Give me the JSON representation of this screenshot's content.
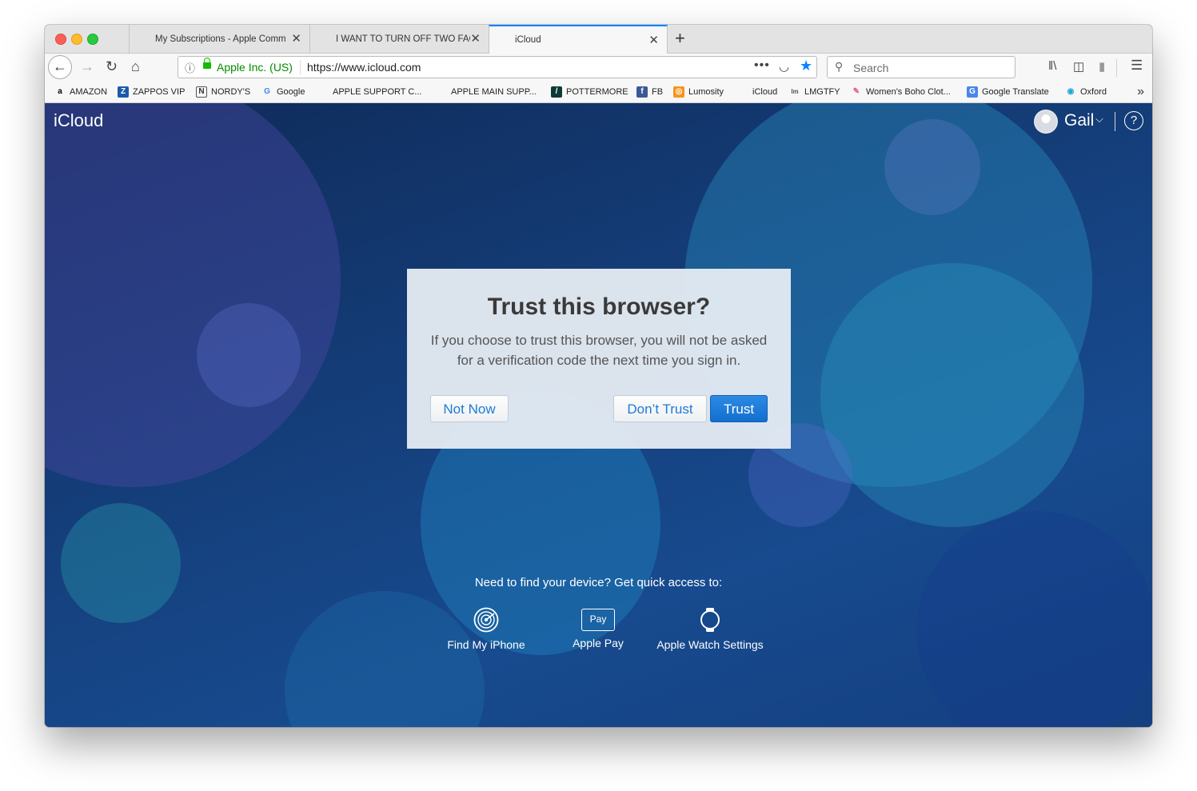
{
  "browser": {
    "tabs": [
      {
        "title": "My Subscriptions - Apple Comm",
        "icon": "apple-icon",
        "active": false
      },
      {
        "title": "I WANT TO TURN OFF TWO FAC",
        "icon": "apple-icon",
        "active": false
      },
      {
        "title": "iCloud",
        "icon": "apple-icon",
        "active": true
      }
    ],
    "url": {
      "organization": "Apple Inc. (US)",
      "address": "https://www.icloud.com"
    },
    "search": {
      "placeholder": "Search"
    },
    "bookmarks": [
      {
        "label": "AMAZON",
        "icon": "amazon-icon"
      },
      {
        "label": "ZAPPOS VIP",
        "icon": "zappos-icon"
      },
      {
        "label": "NORDY'S",
        "icon": "nordstrom-icon"
      },
      {
        "label": "Google",
        "icon": "google-icon"
      },
      {
        "label": "APPLE SUPPORT C...",
        "icon": "apple-icon"
      },
      {
        "label": "APPLE MAIN SUPP...",
        "icon": "apple-icon"
      },
      {
        "label": "POTTERMORE",
        "icon": "pottermore-icon"
      },
      {
        "label": "FB",
        "icon": "facebook-icon"
      },
      {
        "label": "Lumosity",
        "icon": "lumosity-icon"
      },
      {
        "label": "iCloud",
        "icon": "apple-icon"
      },
      {
        "label": "LMGTFY",
        "icon": "lmgtfy-icon"
      },
      {
        "label": "Women's Boho Clot...",
        "icon": "boho-icon"
      },
      {
        "label": "Google Translate",
        "icon": "google-translate-icon"
      },
      {
        "label": "Oxford",
        "icon": "oxford-icon"
      }
    ],
    "accent": "#0a84ff"
  },
  "icloud": {
    "brand": "iCloud",
    "user": "Gail",
    "dialog": {
      "title": "Trust this browser?",
      "body": "If you choose to trust this browser, you will not be asked for a verification code the next time you sign in.",
      "not_now": "Not Now",
      "dont_trust": "Don’t Trust",
      "trust": "Trust"
    },
    "quick_access": {
      "title": "Need to find your device? Get quick access to:",
      "items": [
        {
          "label": "Find My iPhone",
          "icon": "find-my-iphone-icon"
        },
        {
          "label": "Apple Pay",
          "icon": "apple-pay-icon",
          "badge": "Pay"
        },
        {
          "label": "Apple Watch Settings",
          "icon": "apple-watch-icon"
        }
      ]
    },
    "colors": {
      "primary_button": "#1a78d6",
      "background": "#15407d"
    }
  }
}
